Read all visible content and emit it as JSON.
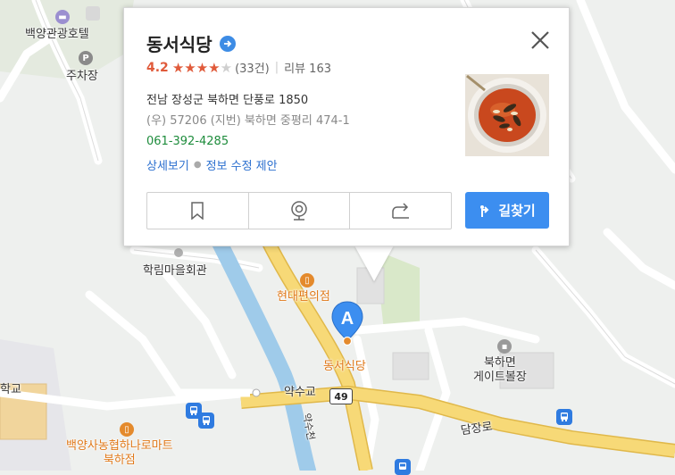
{
  "place": {
    "name": "동서식당",
    "rating": "4.2",
    "stars_filled": 4,
    "stars_total": 5,
    "review_count": "(33건)",
    "blog_review": "리뷰 163",
    "address": "전남 장성군 북하면 단풍로 1850",
    "postal_line": "(우) 57206   (지번) 북하면 중평리 474-1",
    "phone": "061-392-4285",
    "detail_link": "상세보기",
    "edit_link": "정보 수정 제안",
    "route_label": "길찾기",
    "actions": [
      "bookmark-icon",
      "roadview-icon",
      "share-icon"
    ]
  },
  "map": {
    "marker_letter": "A",
    "road_number": "49",
    "labels": {
      "hotel": "백양관광호텔",
      "parking": "주차장",
      "hall": "학림마을회관",
      "store": "현대편의점",
      "restaurant": "동서식당",
      "gateball_1": "북하면",
      "gateball_2": "게이트볼장",
      "bridge": "약수교",
      "road": "담장로",
      "stream": "약수천",
      "coop_1": "백양사농협하나로마트",
      "coop_2": "북하점",
      "school_fragment": "학교"
    },
    "colors": {
      "road_main": "#f7d977",
      "road_outline": "#e0b84a",
      "river": "#9fcbea",
      "accent": "#3c8ef0",
      "poi_orange": "#e48a2c"
    }
  }
}
